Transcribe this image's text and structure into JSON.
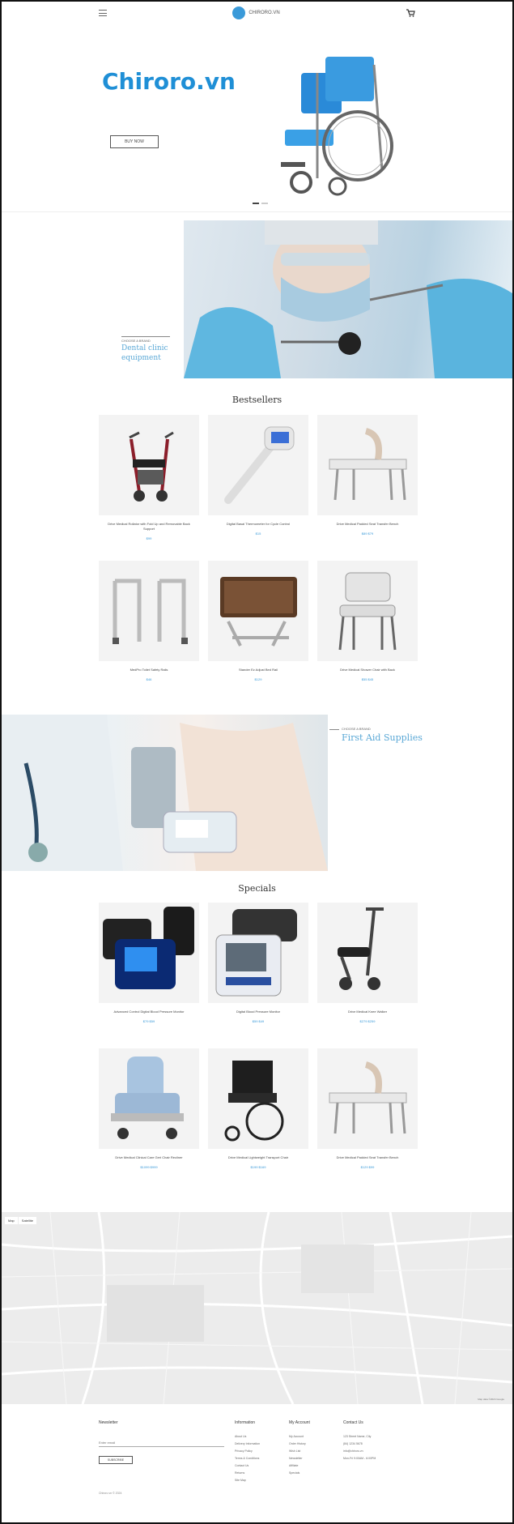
{
  "header": {
    "logo_text": "CHIRORO.VN",
    "accent": "#3a9ad9"
  },
  "hero": {
    "title": "Chiroro.vn",
    "button_label": "BUY NOW",
    "title_color": "#1f8fd6"
  },
  "banner1": {
    "kicker": "CHOOSE A BRAND",
    "title": "Dental clinic equipment"
  },
  "bestsellers": {
    "title": "Bestsellers",
    "products": [
      {
        "name": "Drive Medical Rollator with Fold Up and Removable Back Support",
        "price": "$99"
      },
      {
        "name": "Digital Basal Thermometer for Cycle Control",
        "price": "$15"
      },
      {
        "name": "Drive Medical Padded Seat Transfer Bench",
        "price": "$89 $79"
      },
      {
        "name": "MedPro Toilet Safety Rails",
        "price": "$46"
      },
      {
        "name": "Stander Ez Adjust Bed Rail",
        "price": "$129"
      },
      {
        "name": "Drive Medical Shower Chair with Back",
        "price": "$55 $45"
      }
    ]
  },
  "banner2": {
    "kicker": "CHOOSE A BRAND",
    "title": "First Aid Supplies"
  },
  "specials": {
    "title": "Specials",
    "products": [
      {
        "name": "Advanced Control Digital Blood Pressure Monitor",
        "price": "$79 $59"
      },
      {
        "name": "Digital Blood Pressure Monitor",
        "price": "$59 $49"
      },
      {
        "name": "Drive Medical Knee Walker",
        "price": "$279 $259"
      },
      {
        "name": "Drive Medical Clinical Care Geri Chair Recliner",
        "price": "$1099 $999"
      },
      {
        "name": "Drive Medical Lightweight Transport Chair",
        "price": "$199 $169"
      },
      {
        "name": "Drive Medical Padded Seat Transfer Bench",
        "price": "$129 $99"
      }
    ]
  },
  "map": {
    "tab_map": "Map",
    "tab_satellite": "Satellite",
    "credit": "Map data ©2024 Google"
  },
  "footer": {
    "newsletter": {
      "title": "Newsletter",
      "placeholder": "Enter email",
      "button": "SUBSCRIBE"
    },
    "information": {
      "title": "Information",
      "items": [
        "About Us",
        "Delivery Information",
        "Privacy Policy",
        "Terms & Conditions",
        "Contact Us",
        "Returns",
        "Site Map"
      ]
    },
    "account": {
      "title": "My Account",
      "items": [
        "My Account",
        "Order History",
        "Wish List",
        "Newsletter",
        "Affiliate",
        "Specials"
      ]
    },
    "contact": {
      "title": "Contact Us",
      "items": [
        "123 Street Name, City",
        "(84) 1234 5678",
        "info@chiroro.vn",
        "Mon-Fri 9:00AM - 6:00PM"
      ]
    },
    "copyright": "Chiroro.vn © 2024"
  }
}
